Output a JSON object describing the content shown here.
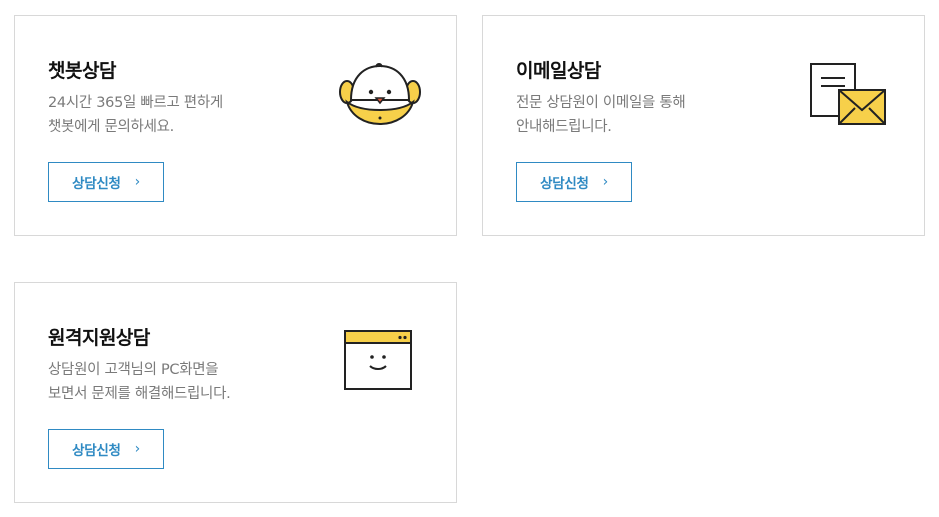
{
  "cards": [
    {
      "title": "챗봇상담",
      "desc": [
        "24시간 365일 빠르고 편하게",
        "챗봇에게 문의하세요."
      ],
      "button_label": "상담신청",
      "button_chevron": "›",
      "icon": "chatbot-icon"
    },
    {
      "title": "이메일상담",
      "desc": [
        "전문 상담원이 이메일을 통해",
        "안내해드립니다."
      ],
      "button_label": "상담신청",
      "button_chevron": "›",
      "icon": "email-icon"
    },
    {
      "title": "원격지원상담",
      "desc": [
        "상담원이 고객님의 PC화면을",
        "보면서 문제를 해결해드립니다."
      ],
      "button_label": "상담신청",
      "button_chevron": "›",
      "icon": "remote-pc-icon"
    }
  ],
  "colors": {
    "accent": "#2f8ac3",
    "icon_yellow": "#f7d04a",
    "border": "#d8d8d8"
  }
}
